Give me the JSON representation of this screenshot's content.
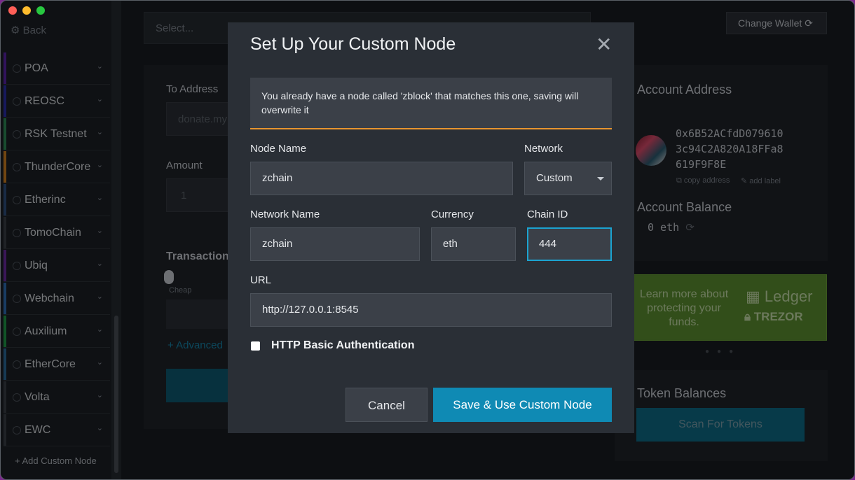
{
  "window": {
    "traffic_lights": {
      "close": "#ff5f57",
      "minimize": "#febc2e",
      "zoom": "#28c840"
    }
  },
  "sidebar": {
    "back_label": "Back",
    "items": [
      {
        "label": "POA",
        "color": "#5a24a8"
      },
      {
        "label": "REOSC",
        "color": "#2a2fa8"
      },
      {
        "label": "RSK Testnet",
        "color": "#2e8b57"
      },
      {
        "label": "ThunderCore",
        "color": "#d0801f"
      },
      {
        "label": "Etherinc",
        "color": "#2e4f7f"
      },
      {
        "label": "TomoChain",
        "color": "#3a3f46"
      },
      {
        "label": "Ubiq",
        "color": "#6a2ba0"
      },
      {
        "label": "Webchain",
        "color": "#2f6eb5"
      },
      {
        "label": "Auxilium",
        "color": "#1f9a48"
      },
      {
        "label": "EtherCore",
        "color": "#2a6a9a"
      },
      {
        "label": "Volta",
        "color": "#3a3f46"
      },
      {
        "label": "EWC",
        "color": "#3a3f46"
      }
    ],
    "add_custom_node": "Add Custom Node"
  },
  "header": {
    "select_placeholder": "Select...",
    "change_wallet": "Change Wallet"
  },
  "form": {
    "to_address_label": "To Address",
    "to_address_placeholder": "donate.my",
    "amount_label": "Amount",
    "amount_placeholder": "1",
    "transaction_label": "Transaction",
    "cheap_label": "Cheap",
    "advanced_label": "+ Advanced"
  },
  "account": {
    "address_label": "Account Address",
    "address_lines": [
      "0x6B52ACfdD079610",
      "3c94C2A820A18FFa8",
      "619F9F8E"
    ],
    "copy_address": "copy address",
    "add_label": "add label",
    "balance_label": "Account Balance",
    "balance_value": "0 eth"
  },
  "promo": {
    "text": "Learn more about protecting your funds.",
    "ledger": "Ledger",
    "trezor": "TREZOR"
  },
  "tokens": {
    "title": "Token Balances",
    "scan_button": "Scan For Tokens"
  },
  "modal": {
    "title": "Set Up Your Custom Node",
    "warning": "You already have a node called 'zblock' that matches this one, saving will overwrite it",
    "node_name_label": "Node Name",
    "node_name_value": "zchain",
    "network_label": "Network",
    "network_value": "Custom",
    "network_name_label": "Network Name",
    "network_name_value": "zchain",
    "currency_label": "Currency",
    "currency_value": "eth",
    "chain_id_label": "Chain ID",
    "chain_id_value": "444",
    "url_label": "URL",
    "url_value": "http://127.0.0.1:8545",
    "http_auth_label": "HTTP Basic Authentication",
    "cancel_label": "Cancel",
    "save_label": "Save & Use Custom Node"
  }
}
